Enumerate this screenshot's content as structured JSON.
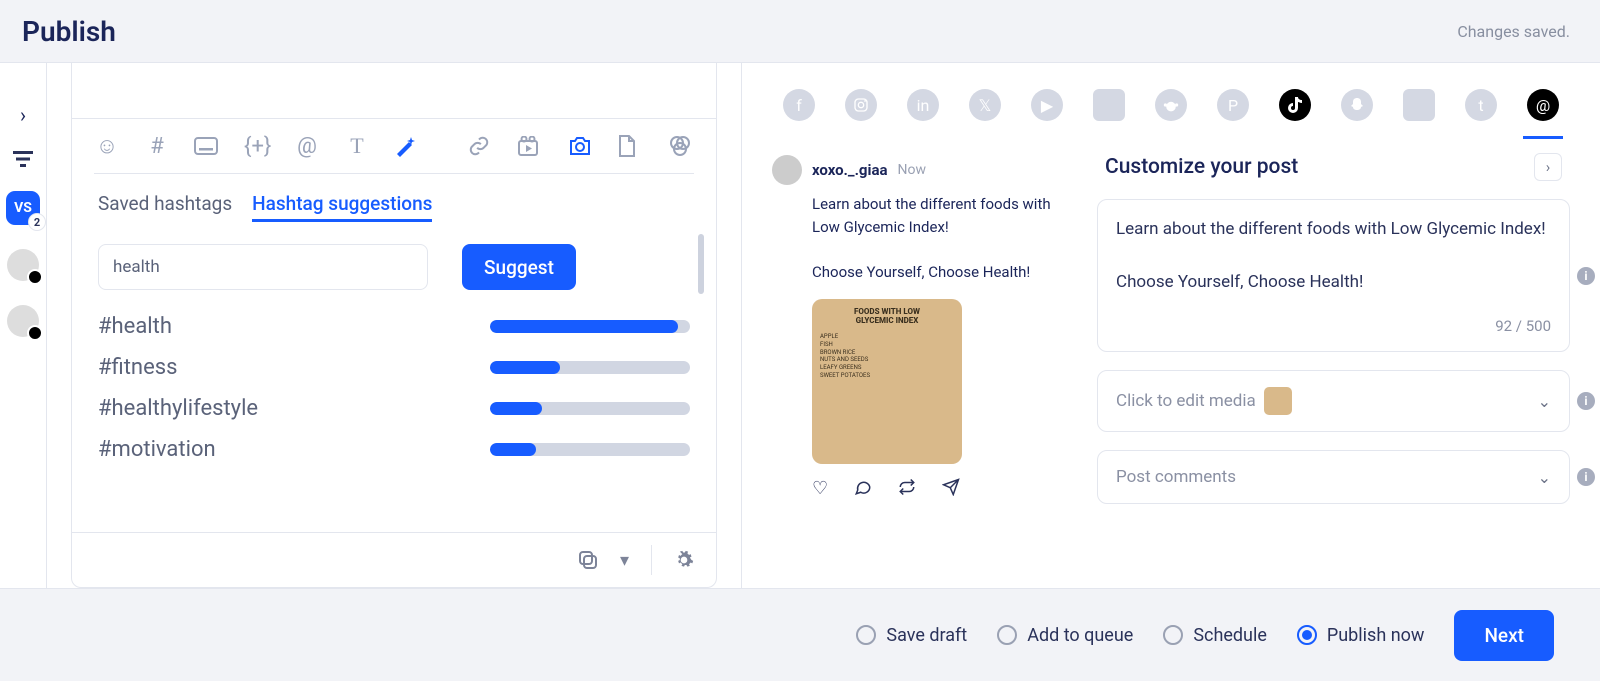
{
  "header": {
    "title": "Publish",
    "status": "Changes saved."
  },
  "rail": {
    "vs_label": "VS",
    "vs_count": "2"
  },
  "toolbar_icons": [
    "emoji",
    "hashtag",
    "caption",
    "template",
    "mention",
    "text",
    "magic",
    "link",
    "video",
    "camera",
    "document",
    "overlap"
  ],
  "hashtag": {
    "tab_saved": "Saved hashtags",
    "tab_suggest": "Hashtag suggestions",
    "input_value": "health",
    "suggest_btn": "Suggest",
    "suggestions": [
      {
        "tag": "#health",
        "score": 94
      },
      {
        "tag": "#fitness",
        "score": 35
      },
      {
        "tag": "#healthylifestyle",
        "score": 26
      },
      {
        "tag": "#motivation",
        "score": 23
      }
    ]
  },
  "social_networks": [
    "facebook",
    "instagram",
    "linkedin",
    "x",
    "youtube",
    "gmb",
    "reddit",
    "pinterest",
    "tiktok",
    "snapchat",
    "blog",
    "tumblr",
    "threads"
  ],
  "preview": {
    "username": "xoxo._.giaa",
    "time": "Now",
    "text": "Learn about the different foods with Low Glycemic Index!\n\nChoose Yourself, Choose Health!",
    "image_title": "FOODS WITH LOW\nGLYCEMIC INDEX",
    "image_items": "APPLE\nFISH\nBROWN RICE\nNUTS AND SEEDS\nLEAFY GREENS\nSWEET POTATOES"
  },
  "customize": {
    "heading": "Customize your post",
    "text": "Learn about the different foods with Low Glycemic Index!\n\nChoose Yourself, Choose Health!",
    "counter": "92 / 500",
    "media_label": "Click to edit media",
    "comments_label": "Post comments"
  },
  "footer": {
    "save_draft": "Save draft",
    "add_queue": "Add to queue",
    "schedule": "Schedule",
    "publish_now": "Publish now",
    "next": "Next"
  }
}
